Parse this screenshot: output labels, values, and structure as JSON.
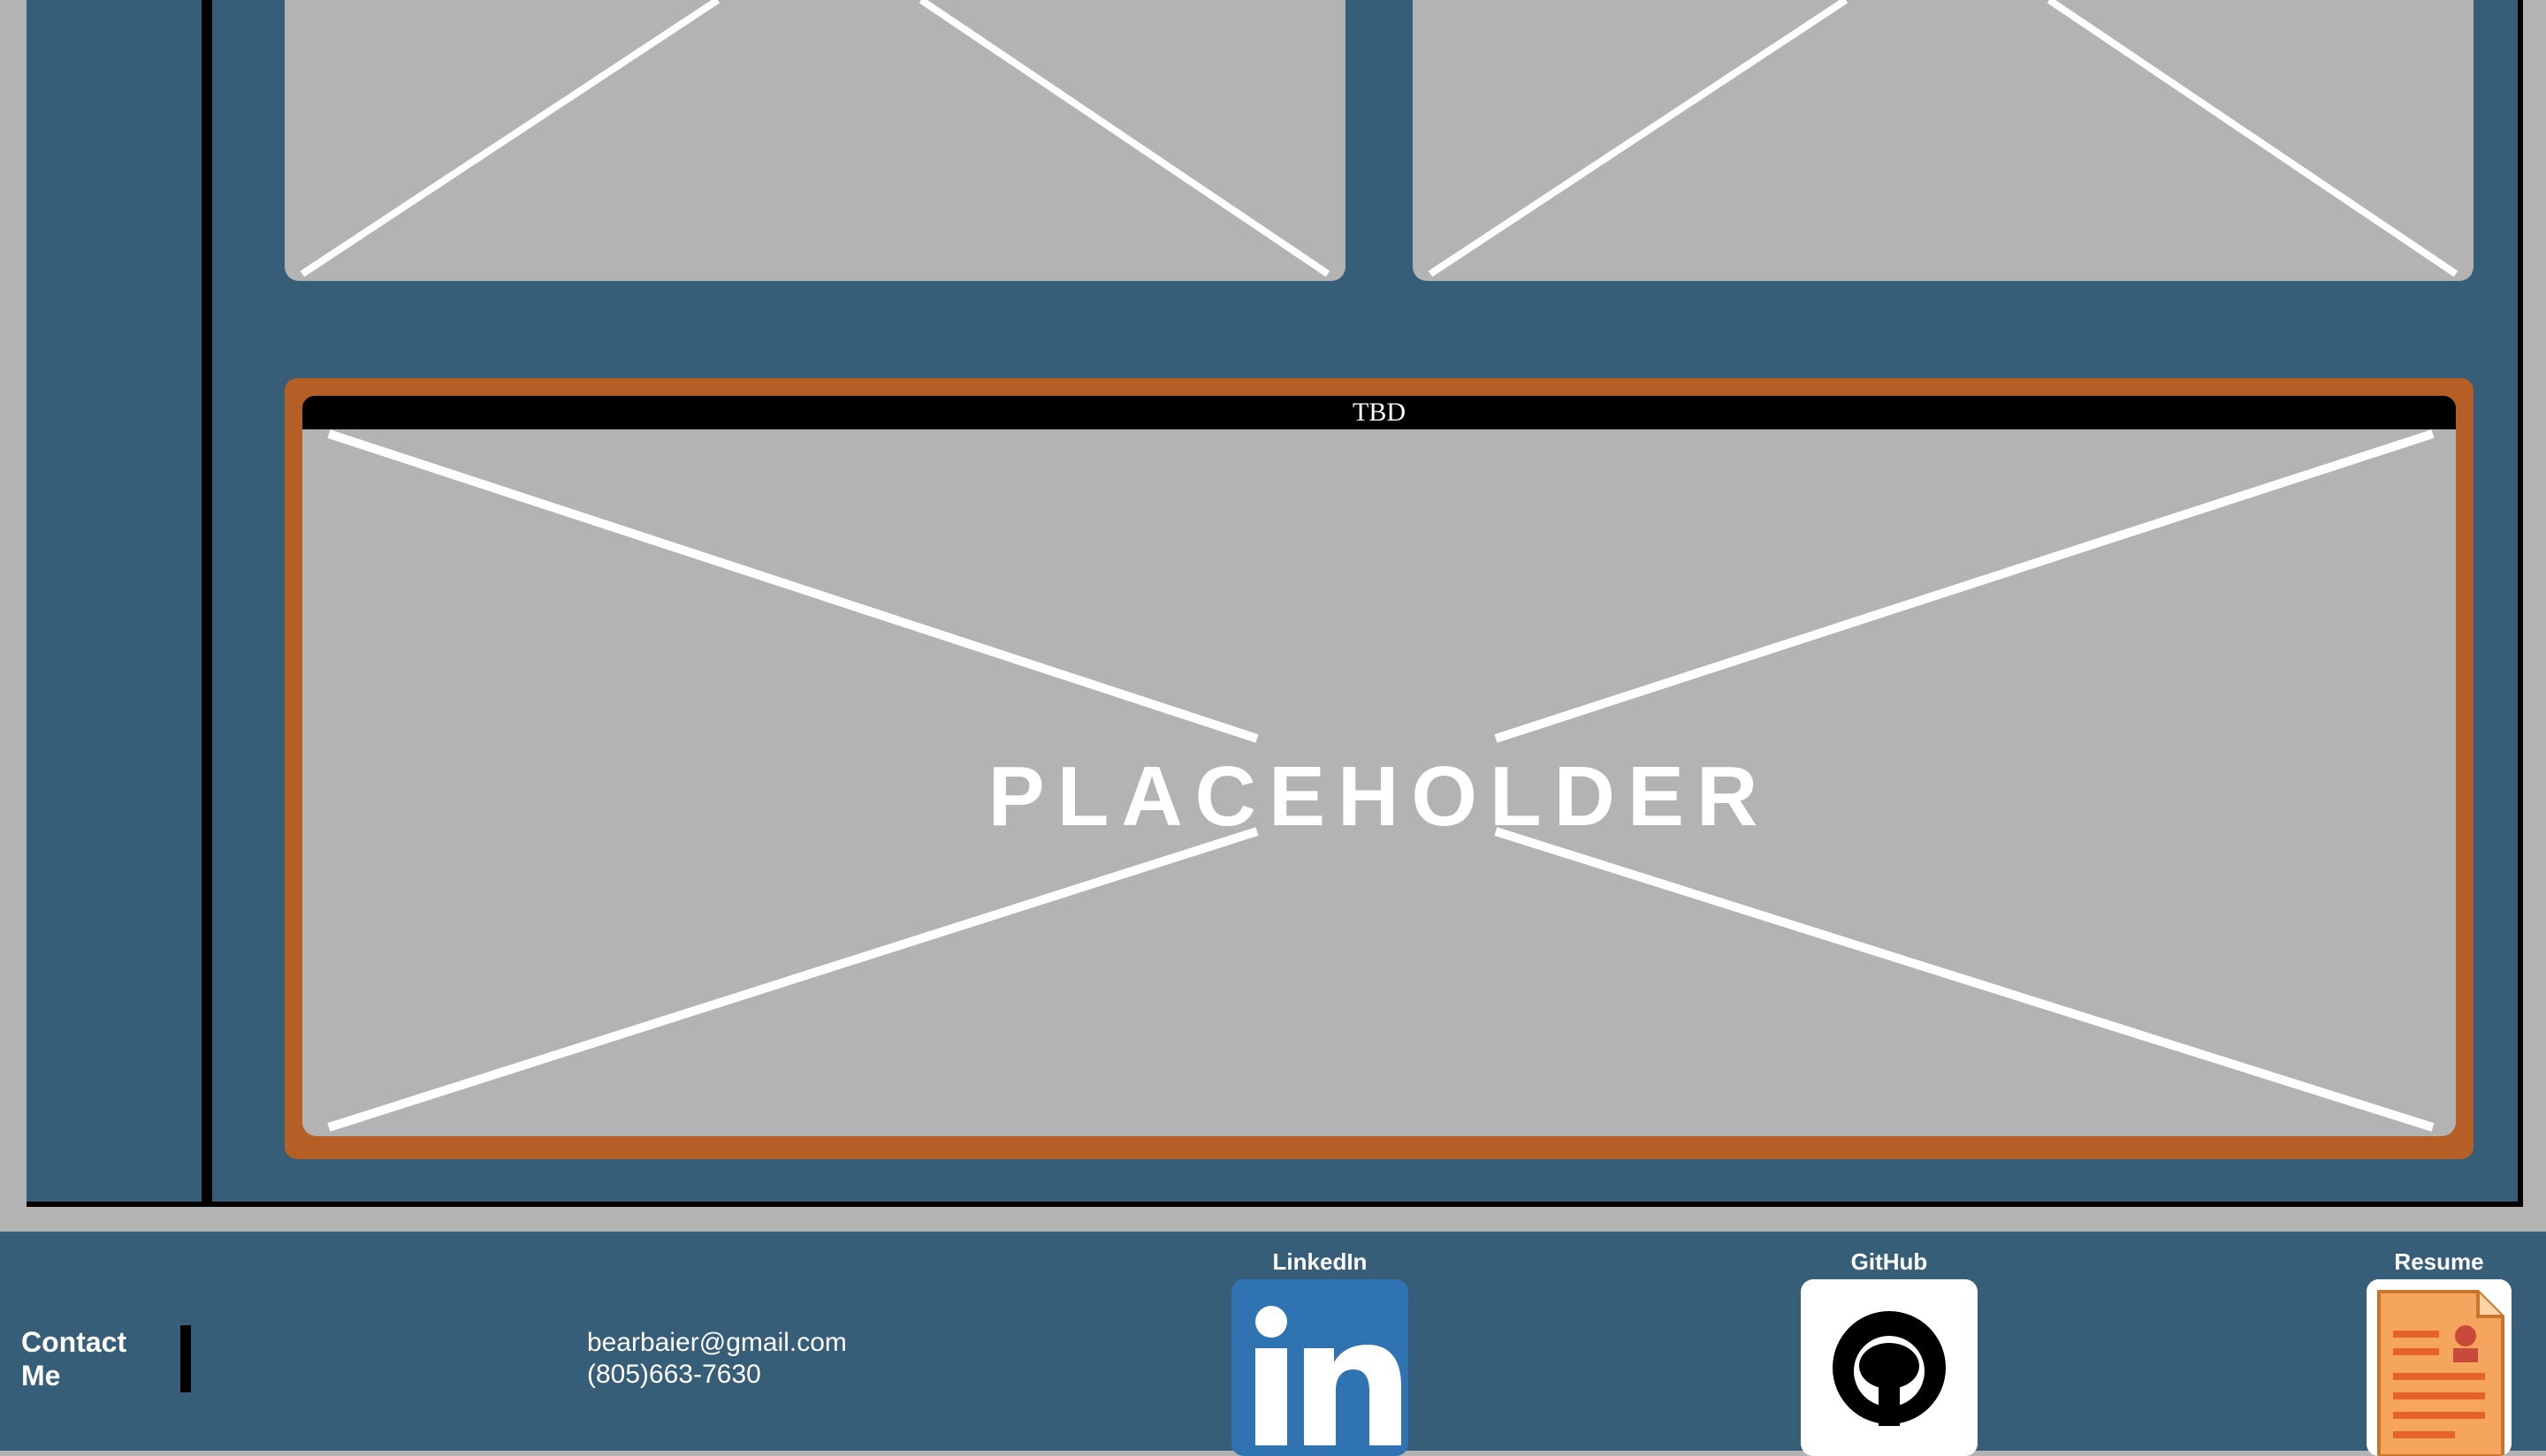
{
  "projects": [
    {
      "title": "",
      "image": "placeholder-image"
    },
    {
      "title": "",
      "image": "placeholder-image"
    },
    {
      "title": "TBD",
      "image": "placeholder-image",
      "placeholder_text": "PLACEHOLDER"
    }
  ],
  "footer": {
    "contact_heading": "Contact Me",
    "email": "bearbaier@gmail.com",
    "phone": "(805)663-7630",
    "links": [
      {
        "label": "LinkedIn",
        "icon": "linkedin-icon"
      },
      {
        "label": "GitHub",
        "icon": "github-icon"
      },
      {
        "label": "Resume",
        "icon": "resume-icon"
      }
    ]
  },
  "colors": {
    "panel": "#365e78",
    "page_background": "#b3b3b3",
    "card_border": "#b55f27",
    "linkedin": "#2f73b2",
    "resume": "#f6a55e"
  }
}
